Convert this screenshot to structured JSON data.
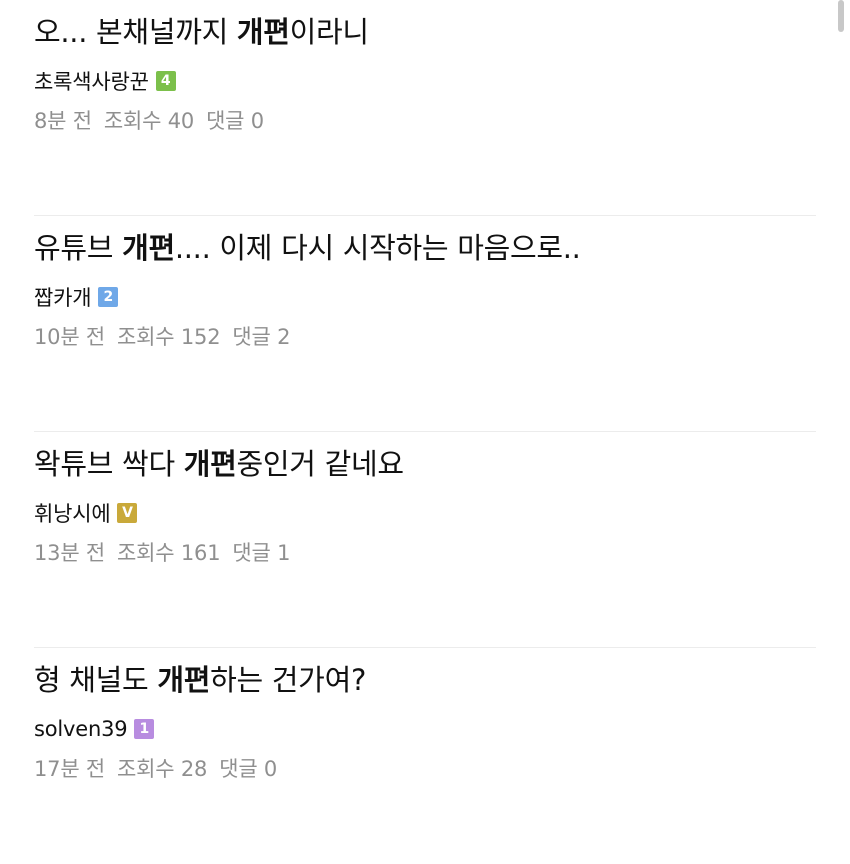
{
  "posts": [
    {
      "title_before": "오... 본채널까지 ",
      "title_bold": "개편",
      "title_after": "이라니",
      "author": "초록색사랑꾼",
      "badge": "4",
      "badge_color": "#7cc04b",
      "time": "8분 전",
      "views": "조회수 40",
      "comments": "댓글 0"
    },
    {
      "title_before": "유튜브 ",
      "title_bold": "개편",
      "title_after": ".... 이제 다시 시작하는 마음으로..",
      "author": "짭카개",
      "badge": "2",
      "badge_color": "#6fa8e8",
      "time": "10분 전",
      "views": "조회수 152",
      "comments": "댓글 2"
    },
    {
      "title_before": "왁튜브 싹다 ",
      "title_bold": "개편",
      "title_after": "중인거 같네요",
      "author": "휘낭시에",
      "badge": "V",
      "badge_color": "#c9a93a",
      "time": "13분 전",
      "views": "조회수 161",
      "comments": "댓글 1"
    },
    {
      "title_before": "형 채널도 ",
      "title_bold": "개편",
      "title_after": "하는 건가여?",
      "author": "solven39",
      "badge": "1",
      "badge_color": "#b88ce0",
      "time": "17분 전",
      "views": "조회수 28",
      "comments": "댓글 0"
    }
  ]
}
